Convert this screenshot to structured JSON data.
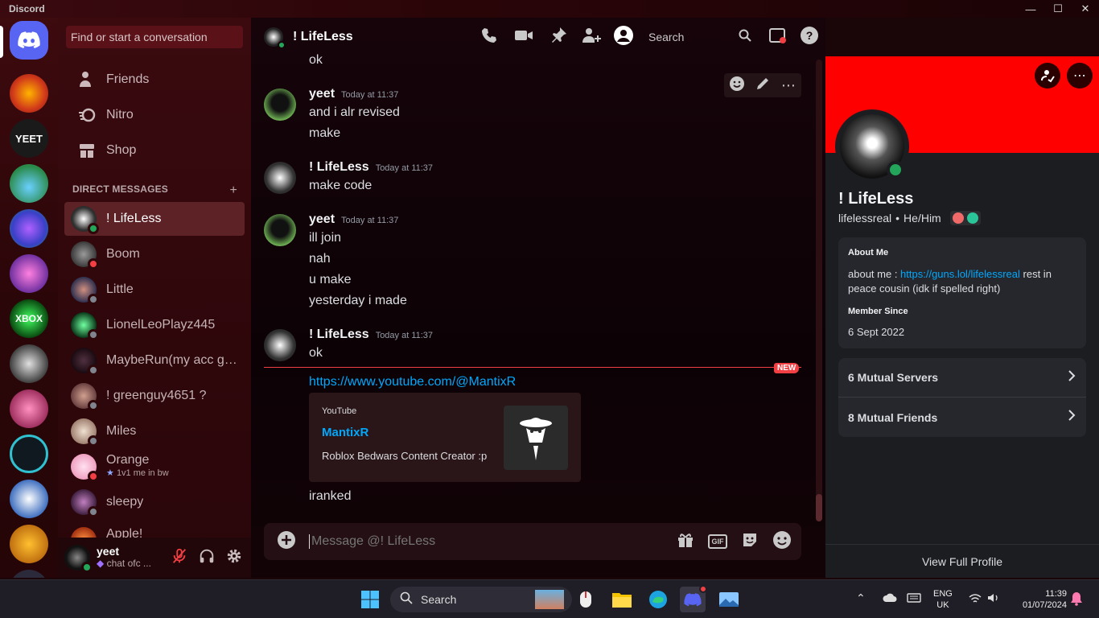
{
  "app": {
    "title": "Discord"
  },
  "dms": {
    "search_placeholder": "Find or start a conversation",
    "nav": [
      {
        "label": "Friends"
      },
      {
        "label": "Nitro"
      },
      {
        "label": "Shop"
      }
    ],
    "header": "DIRECT MESSAGES",
    "add_symbol": "+",
    "items": [
      {
        "name": "! LifeLess",
        "status": "online"
      },
      {
        "name": "Boom",
        "status": "dnd"
      },
      {
        "name": "Little",
        "status": "offline"
      },
      {
        "name": "LionelLeoPlayz445",
        "status": "offline"
      },
      {
        "name": "MaybeRun(my acc got...",
        "status": "offline"
      },
      {
        "name": "! greenguy4651 ?",
        "status": "offline"
      },
      {
        "name": "Miles",
        "status": "offline"
      },
      {
        "name": "Orange",
        "status": "dnd",
        "substatus": "1v1 me in bw"
      },
      {
        "name": "sleepy",
        "status": "offline"
      },
      {
        "name": "Apple!",
        "status": "offline"
      }
    ]
  },
  "user_panel": {
    "username": "yeet",
    "status": "chat ofc ..."
  },
  "chat": {
    "channel_name": "! LifeLess",
    "search_label": "Search",
    "messages": [
      {
        "lines": [
          "ok"
        ]
      },
      {
        "author": "yeet",
        "time": "Today at 11:37",
        "lines": [
          "and i alr revised",
          "make"
        ]
      },
      {
        "author": "! LifeLess",
        "time": "Today at 11:37",
        "lines": [
          "make code"
        ]
      },
      {
        "author": "yeet",
        "time": "Today at 11:37",
        "lines": [
          "ill join",
          "nah",
          "u make",
          "yesterday i made"
        ]
      },
      {
        "author": "! LifeLess",
        "time": "Today at 11:37",
        "lines": [
          "ok"
        ]
      }
    ],
    "new_badge": "NEW",
    "link": "https://www.youtube.com/@MantixR",
    "embed": {
      "provider": "YouTube",
      "title": "MantixR",
      "description": "Roblox Bedwars Content Creator :p"
    },
    "last_message": "iranked",
    "composer_placeholder": "Message @! LifeLess",
    "gif_label": "GIF"
  },
  "profile": {
    "display_name": "! LifeLess",
    "username": "lifelessreal",
    "pronouns": "He/Him",
    "separator": "•",
    "about_heading": "About Me",
    "about_prefix": "about me : ",
    "about_link": "https://guns.lol/lifelessreal",
    "about_suffix": " rest in peace cousin (idk if spelled right)",
    "member_since_heading": "Member Since",
    "member_since": "6 Sept 2022",
    "mutual_servers": "6 Mutual Servers",
    "mutual_friends": "8 Mutual Friends",
    "view_full": "View Full Profile",
    "banner_color": "#ff0000"
  },
  "taskbar": {
    "search_label": "Search",
    "lang_top": "ENG",
    "lang_bottom": "UK",
    "time": "11:39",
    "date": "01/07/2024"
  }
}
